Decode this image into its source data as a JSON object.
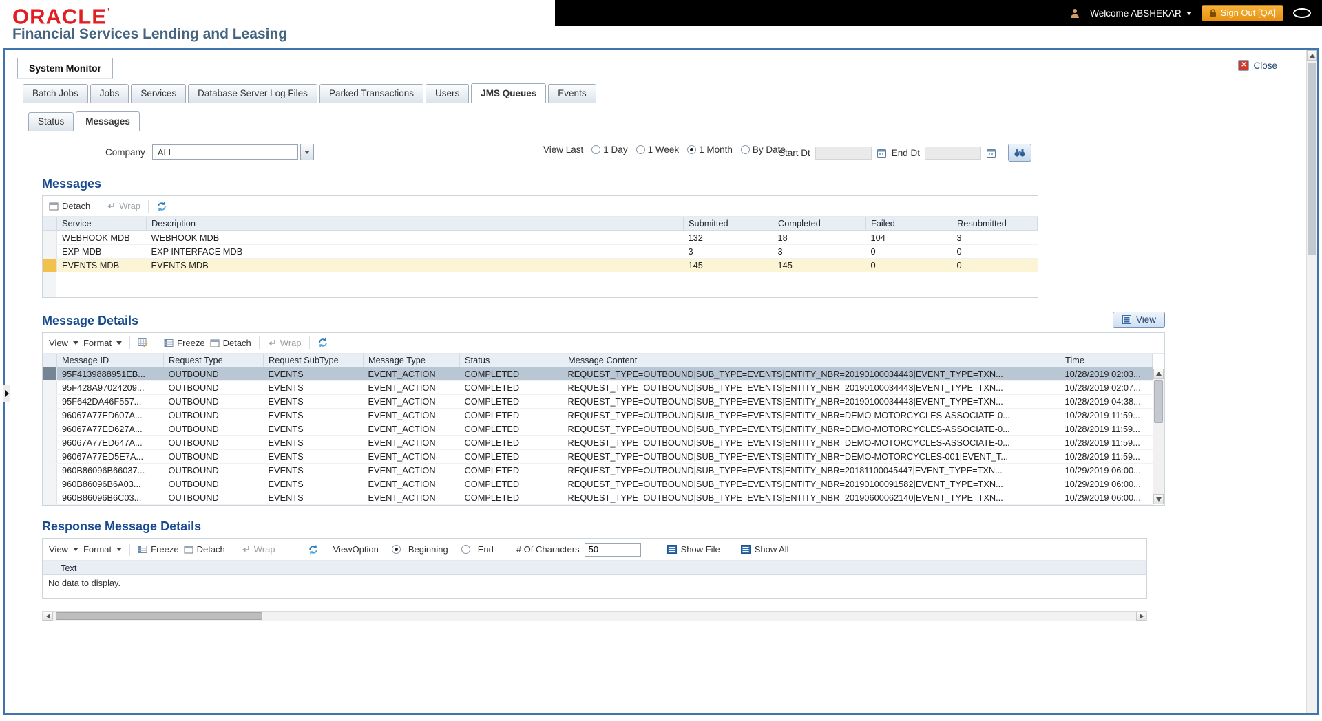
{
  "header": {
    "logo_text": "ORACLE",
    "logo_mark": "'",
    "tagline": "Financial Services Lending and Leasing",
    "welcome": "Welcome ABSHEKAR",
    "sign_out": "Sign Out [QA]"
  },
  "window": {
    "title": "System Monitor",
    "close": "Close"
  },
  "tabs": [
    {
      "label": "Batch Jobs"
    },
    {
      "label": "Jobs"
    },
    {
      "label": "Services"
    },
    {
      "label": "Database Server Log Files"
    },
    {
      "label": "Parked Transactions"
    },
    {
      "label": "Users"
    },
    {
      "label": "JMS Queues"
    },
    {
      "label": "Events"
    }
  ],
  "subtabs": [
    {
      "label": "Status"
    },
    {
      "label": "Messages"
    }
  ],
  "filters": {
    "company_label": "Company",
    "company_value": "ALL",
    "view_last_label": "View Last",
    "options": [
      {
        "label": "1 Day",
        "selected": false
      },
      {
        "label": "1 Week",
        "selected": false
      },
      {
        "label": "1 Month",
        "selected": true
      },
      {
        "label": "By Date",
        "selected": false
      }
    ],
    "start_dt_label": "Start Dt",
    "start_dt_value": "",
    "end_dt_label": "End Dt",
    "end_dt_value": ""
  },
  "messages": {
    "title": "Messages",
    "toolbar": {
      "detach": "Detach",
      "wrap": "Wrap"
    },
    "columns": [
      "Service",
      "Description",
      "Submitted",
      "Completed",
      "Failed",
      "Resubmitted"
    ],
    "rows": [
      {
        "service": "WEBHOOK MDB",
        "description": "WEBHOOK MDB",
        "submitted": "132",
        "completed": "18",
        "failed": "104",
        "resubmitted": "3",
        "selected": false
      },
      {
        "service": "EXP MDB",
        "description": "EXP INTERFACE MDB",
        "submitted": "3",
        "completed": "3",
        "failed": "0",
        "resubmitted": "0",
        "selected": false
      },
      {
        "service": "EVENTS MDB",
        "description": "EVENTS MDB",
        "submitted": "145",
        "completed": "145",
        "failed": "0",
        "resubmitted": "0",
        "selected": true
      }
    ]
  },
  "message_details": {
    "title": "Message Details",
    "view_button": "View",
    "toolbar": {
      "view": "View",
      "format": "Format",
      "freeze": "Freeze",
      "detach": "Detach",
      "wrap": "Wrap"
    },
    "columns": [
      "Message ID",
      "Request Type",
      "Request SubType",
      "Message Type",
      "Status",
      "Message Content",
      "Time"
    ],
    "rows": [
      {
        "id": "95F4139888951EB...",
        "req": "OUTBOUND",
        "sub": "EVENTS",
        "type": "EVENT_ACTION",
        "status": "COMPLETED",
        "content": "REQUEST_TYPE=OUTBOUND|SUB_TYPE=EVENTS|ENTITY_NBR=20190100034443|EVENT_TYPE=TXN...",
        "time": "10/28/2019 02:03...",
        "selected": true
      },
      {
        "id": "95F428A97024209...",
        "req": "OUTBOUND",
        "sub": "EVENTS",
        "type": "EVENT_ACTION",
        "status": "COMPLETED",
        "content": "REQUEST_TYPE=OUTBOUND|SUB_TYPE=EVENTS|ENTITY_NBR=20190100034443|EVENT_TYPE=TXN...",
        "time": "10/28/2019 02:07...",
        "selected": false
      },
      {
        "id": "95F642DA46F557...",
        "req": "OUTBOUND",
        "sub": "EVENTS",
        "type": "EVENT_ACTION",
        "status": "COMPLETED",
        "content": "REQUEST_TYPE=OUTBOUND|SUB_TYPE=EVENTS|ENTITY_NBR=20190100034443|EVENT_TYPE=TXN...",
        "time": "10/28/2019 04:38...",
        "selected": false
      },
      {
        "id": "96067A77ED607A...",
        "req": "OUTBOUND",
        "sub": "EVENTS",
        "type": "EVENT_ACTION",
        "status": "COMPLETED",
        "content": "REQUEST_TYPE=OUTBOUND|SUB_TYPE=EVENTS|ENTITY_NBR=DEMO-MOTORCYCLES-ASSOCIATE-0...",
        "time": "10/28/2019 11:59...",
        "selected": false
      },
      {
        "id": "96067A77ED627A...",
        "req": "OUTBOUND",
        "sub": "EVENTS",
        "type": "EVENT_ACTION",
        "status": "COMPLETED",
        "content": "REQUEST_TYPE=OUTBOUND|SUB_TYPE=EVENTS|ENTITY_NBR=DEMO-MOTORCYCLES-ASSOCIATE-0...",
        "time": "10/28/2019 11:59...",
        "selected": false
      },
      {
        "id": "96067A77ED647A...",
        "req": "OUTBOUND",
        "sub": "EVENTS",
        "type": "EVENT_ACTION",
        "status": "COMPLETED",
        "content": "REQUEST_TYPE=OUTBOUND|SUB_TYPE=EVENTS|ENTITY_NBR=DEMO-MOTORCYCLES-ASSOCIATE-0...",
        "time": "10/28/2019 11:59...",
        "selected": false
      },
      {
        "id": "96067A77ED5E7A...",
        "req": "OUTBOUND",
        "sub": "EVENTS",
        "type": "EVENT_ACTION",
        "status": "COMPLETED",
        "content": "REQUEST_TYPE=OUTBOUND|SUB_TYPE=EVENTS|ENTITY_NBR=DEMO-MOTORCYCLES-001|EVENT_T...",
        "time": "10/28/2019 11:59...",
        "selected": false
      },
      {
        "id": "960B86096B66037...",
        "req": "OUTBOUND",
        "sub": "EVENTS",
        "type": "EVENT_ACTION",
        "status": "COMPLETED",
        "content": "REQUEST_TYPE=OUTBOUND|SUB_TYPE=EVENTS|ENTITY_NBR=20181100045447|EVENT_TYPE=TXN...",
        "time": "10/29/2019 06:00...",
        "selected": false
      },
      {
        "id": "960B86096B6A03...",
        "req": "OUTBOUND",
        "sub": "EVENTS",
        "type": "EVENT_ACTION",
        "status": "COMPLETED",
        "content": "REQUEST_TYPE=OUTBOUND|SUB_TYPE=EVENTS|ENTITY_NBR=20190100091582|EVENT_TYPE=TXN...",
        "time": "10/29/2019 06:00...",
        "selected": false
      },
      {
        "id": "960B86096B6C03...",
        "req": "OUTBOUND",
        "sub": "EVENTS",
        "type": "EVENT_ACTION",
        "status": "COMPLETED",
        "content": "REQUEST_TYPE=OUTBOUND|SUB_TYPE=EVENTS|ENTITY_NBR=20190600062140|EVENT_TYPE=TXN...",
        "time": "10/29/2019 06:00...",
        "selected": false
      }
    ]
  },
  "response_details": {
    "title": "Response Message Details",
    "toolbar": {
      "view": "View",
      "format": "Format",
      "freeze": "Freeze",
      "detach": "Detach",
      "wrap": "Wrap"
    },
    "view_option_label": "ViewOption",
    "view_options": [
      {
        "label": "Beginning",
        "selected": true
      },
      {
        "label": "End",
        "selected": false
      }
    ],
    "chars_label": "# Of Characters",
    "chars_value": "50",
    "show_file": "Show File",
    "show_all": "Show All",
    "column": "Text",
    "empty_text": "No data to display."
  }
}
